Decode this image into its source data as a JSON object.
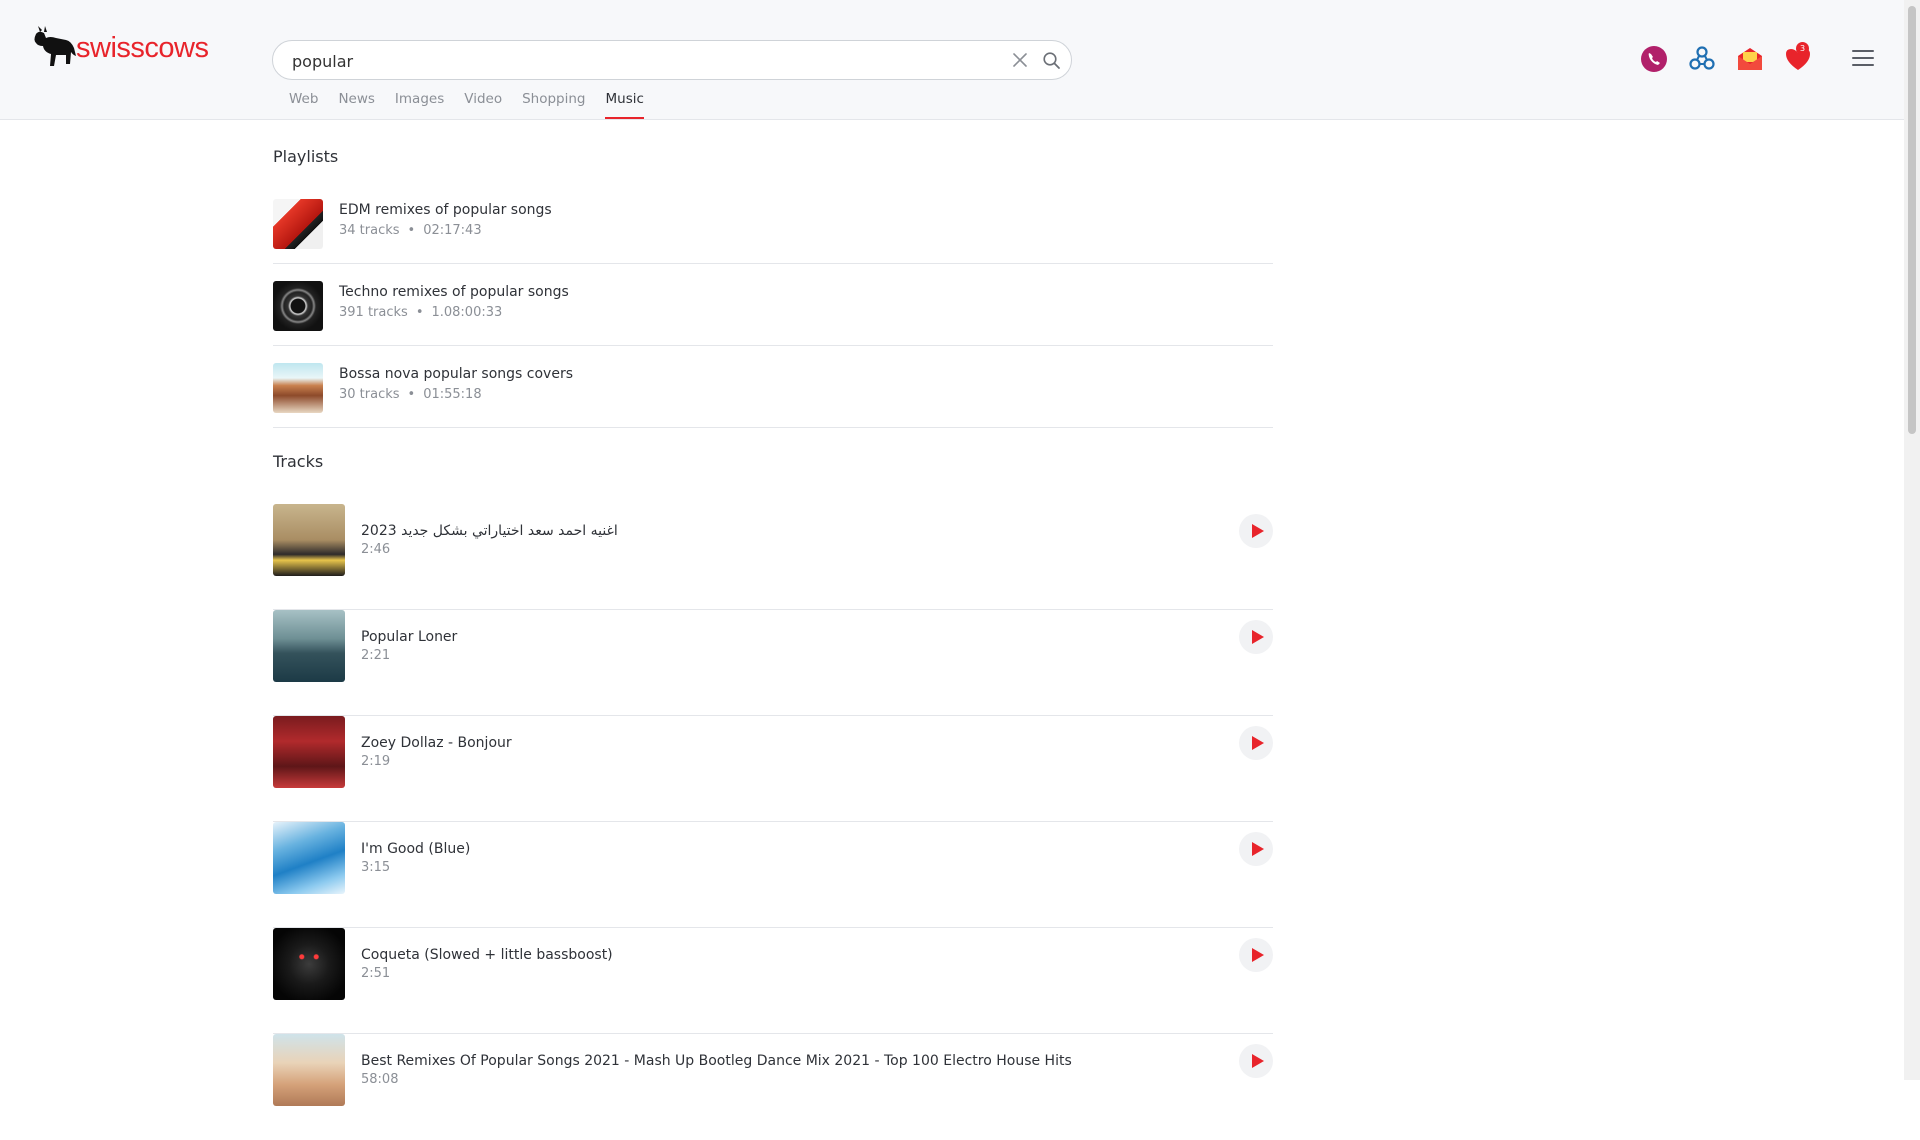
{
  "brand": {
    "name": "swisscows"
  },
  "search": {
    "value": "popular",
    "placeholder": ""
  },
  "tabs": [
    {
      "label": "Web"
    },
    {
      "label": "News"
    },
    {
      "label": "Images"
    },
    {
      "label": "Video"
    },
    {
      "label": "Shopping"
    },
    {
      "label": "Music",
      "active": true
    }
  ],
  "header_icons": {
    "vpn": "phone-shield-icon",
    "teleguard": "network-icon",
    "mail": "email-icon",
    "favorites": "heart-icon",
    "favorites_count": "3",
    "menu": "hamburger-menu-icon"
  },
  "sections": {
    "playlists_title": "Playlists",
    "tracks_title": "Tracks"
  },
  "playlists": [
    {
      "title": "EDM remixes of popular songs",
      "tracks": "34 tracks",
      "duration": "02:17:43"
    },
    {
      "title": "Techno remixes of popular songs",
      "tracks": "391 tracks",
      "duration": "1.08:00:33"
    },
    {
      "title": "Bossa nova popular songs covers",
      "tracks": "30 tracks",
      "duration": "01:55:18"
    }
  ],
  "tracks": [
    {
      "title": "اغنيه احمد سعد اختياراتي بشكل جديد 2023",
      "duration": "2:46"
    },
    {
      "title": "Popular Loner",
      "duration": "2:21"
    },
    {
      "title": "Zoey Dollaz - Bonjour",
      "duration": "2:19"
    },
    {
      "title": "I'm Good (Blue)",
      "duration": "3:15"
    },
    {
      "title": "Coqueta (Slowed + little bassboost)",
      "duration": "2:51"
    },
    {
      "title": "Best Remixes Of Popular Songs 2021 - Mash Up Bootleg Dance Mix 2021 - Top 100 Electro House Hits",
      "duration": "58:08"
    }
  ],
  "colors": {
    "accent": "#e8242b",
    "header_bg": "#f7f8fa",
    "text": "#2f3238",
    "muted": "#8b8f96"
  }
}
